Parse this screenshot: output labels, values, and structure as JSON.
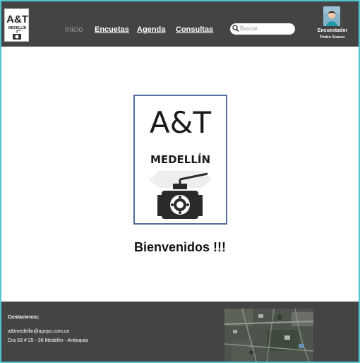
{
  "brand": {
    "logo_text": "A&T",
    "logo_city": "MEDELLÍN"
  },
  "nav": {
    "items": [
      {
        "label": "Inicio",
        "active": true
      },
      {
        "label": "Encuetas",
        "active": false
      },
      {
        "label": "Agenda",
        "active": false
      },
      {
        "label": "Consultas",
        "active": false
      }
    ]
  },
  "search": {
    "placeholder": "Buscar",
    "icon": "search-icon"
  },
  "user": {
    "role": "Encuestador",
    "name": "Pedro Suarez",
    "icon": "avatar"
  },
  "main": {
    "welcome": "Bienvenidos !!!"
  },
  "footer": {
    "contact_title": "Contactenos:",
    "email": "a&tmedellin@apoyo.com.co",
    "address": "Cra 53 # 25 - 36  Medellin - Antioquia"
  },
  "colors": {
    "header_bg": "#444444",
    "footer_bg": "#444444",
    "border_accent": "#4fc6cf",
    "logo_border": "#5070a0"
  }
}
